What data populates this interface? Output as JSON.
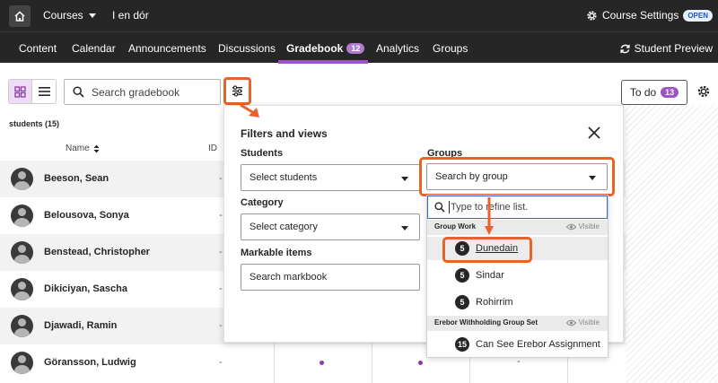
{
  "topbar": {
    "courses_label": "Courses",
    "course_name": "I en dór",
    "course_settings_label": "Course Settings",
    "open_badge": "OPEN"
  },
  "nav": {
    "items": [
      "Content",
      "Calendar",
      "Announcements",
      "Discussions",
      "Gradebook",
      "Analytics",
      "Groups"
    ],
    "gradebook_count": "12",
    "student_preview": "Student Preview"
  },
  "toolbar": {
    "search_placeholder": "Search gradebook",
    "todo_label": "To do",
    "todo_count": "13"
  },
  "table": {
    "students_count": "students (15)",
    "col_name": "Name",
    "col_id": "ID",
    "rows": [
      {
        "name": "Beeson, Sean",
        "id": "-"
      },
      {
        "name": "Belousova, Sonya",
        "id": "-"
      },
      {
        "name": "Benstead, Christopher",
        "id": "-"
      },
      {
        "name": "Dikiciyan, Sascha",
        "id": "-"
      },
      {
        "name": "Djawadi, Ramin",
        "id": "-"
      },
      {
        "name": "Göransson, Ludwig",
        "id": "-"
      }
    ],
    "last_row_dash": "-"
  },
  "panel": {
    "title": "Filters and views",
    "students_label": "Students",
    "students_select": "Select students",
    "category_label": "Category",
    "category_select": "Select category",
    "markable_label": "Markable items",
    "markable_placeholder": "Search markbook",
    "groups_label": "Groups",
    "groups_select": "Search by group"
  },
  "dropdown": {
    "filter_placeholder": "Type to refine list.",
    "visible_label": "Visible",
    "sets": [
      {
        "name": "Group Work",
        "groups": [
          {
            "count": "5",
            "name": "Dunedain"
          },
          {
            "count": "5",
            "name": "Sindar"
          },
          {
            "count": "5",
            "name": "Rohirrim"
          }
        ]
      },
      {
        "name": "Erebor Withholding Group Set",
        "groups": [
          {
            "count": "15",
            "name": "Can See Erebor Assignment"
          }
        ]
      }
    ]
  },
  "colors": {
    "accent_purple": "#9d52c6",
    "highlight_orange": "#e8622c",
    "topbar": "#262626"
  }
}
